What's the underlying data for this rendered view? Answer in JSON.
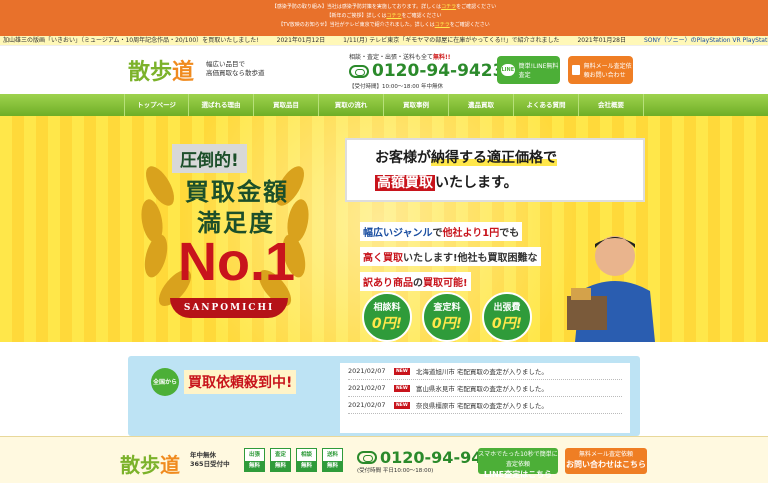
{
  "alerts": [
    {
      "tag": "【感染予防の取り組み】",
      "text": "当社は感染予防対策を実施しております。詳しくは",
      "link": "コチラ",
      "tail": "をご確認ください"
    },
    {
      "tag": "【新年のご挨拶】",
      "text": "詳しくは",
      "link": "コチラ",
      "tail": "をご確認ください"
    },
    {
      "tag": "【TV放映のお知らせ】",
      "text": "当社がテレビ東京で紹介されました。詳しくは",
      "link": "コチラ",
      "tail": "をご確認ください"
    }
  ],
  "ticker": [
    {
      "text": "加山雄三の版画「いきおい」（ミュージアム・10周年記念作品・20/100）を買取いたしました!",
      "link": false
    },
    {
      "text": "2021年01月12日",
      "link": false
    },
    {
      "text": "1/11(月) テレビ東京「ギモヤマの部屋に在庫がやってくる!!」で紹介されました",
      "link": false
    },
    {
      "text": "2021年01月28日",
      "link": false
    },
    {
      "text": "SONY（ソニー）のPlayStation VR PlayStation Camera",
      "link": true
    }
  ],
  "header": {
    "logo_a": "散歩",
    "logo_b": "道",
    "tagline_1": "幅広い品目で",
    "tagline_2": "高価買取なら散歩道",
    "free_text": "相談・査定・出張・送料も全て",
    "free_bold": "無料!!",
    "phone": "0120-94-9423",
    "hours": "【受付時間】10:00〜18:00 年中無休",
    "line_icon": "LINE",
    "line_label": "簡単!LINE無料査定",
    "mail_label": "無料メール査定依頼お問い合わせ"
  },
  "nav": [
    "トップページ",
    "選ばれる理由",
    "買取品目",
    "買取の流れ",
    "買取事例",
    "遺品買取",
    "よくある質問",
    "会社概要"
  ],
  "hero": {
    "tag": "圧倒的!",
    "big1": "買取金額",
    "big2": "満足度",
    "no1": "No.1",
    "ribbon": "SANPOMICHI",
    "banner_l1_a": "お客様が",
    "banner_l1_b": "納得する適正価格で",
    "banner_l2_a": "高額買取",
    "banner_l2_b": "いたします。",
    "p1_a": "幅広いジャンル",
    "p1_b": "で",
    "p1_c": "他社より1円",
    "p1_d": "でも",
    "p2_a": "高く買取",
    "p2_b": "いたします!他社も買取困難な",
    "p3_a": "訳あり商品",
    "p3_b": "の",
    "p3_c": "買取可能!",
    "circles": [
      {
        "label": "相談料",
        "value": "0円!"
      },
      {
        "label": "査定料",
        "value": "0円!"
      },
      {
        "label": "出張費",
        "value": "0円!"
      }
    ]
  },
  "news": {
    "badge": "全国から",
    "title": "買取依頼殺到中!",
    "new_label": "NEW",
    "items": [
      {
        "date": "2021/02/07",
        "text": "北海道旭川市 宅配買取の査定が入りました。"
      },
      {
        "date": "2021/02/07",
        "text": "富山県氷見市 宅配買取の査定が入りました。"
      },
      {
        "date": "2021/02/07",
        "text": "奈良県橿原市 宅配買取の査定が入りました。"
      }
    ]
  },
  "footer": {
    "logo_a": "散歩",
    "logo_b": "道",
    "open_1": "年中無休",
    "open_2": "365日受付中",
    "badges": [
      {
        "top": "出張",
        "bottom": "無料"
      },
      {
        "top": "査定",
        "bottom": "無料"
      },
      {
        "top": "相談",
        "bottom": "無料"
      },
      {
        "top": "送料",
        "bottom": "無料"
      }
    ],
    "phone": "0120-94-9423",
    "hours": "(受付時間 平日10:00〜18:00)",
    "line_small": "スマホでたった10秒で簡単に査定依頼",
    "line_big": "LINE査定はこちら",
    "mail_small": "無料メール査定依頼",
    "mail_big": "お問い合わせはこちら"
  },
  "colors": {
    "brand_green": "#6fae26",
    "accent_orange": "#e8712b",
    "accent_red": "#c8141c"
  }
}
